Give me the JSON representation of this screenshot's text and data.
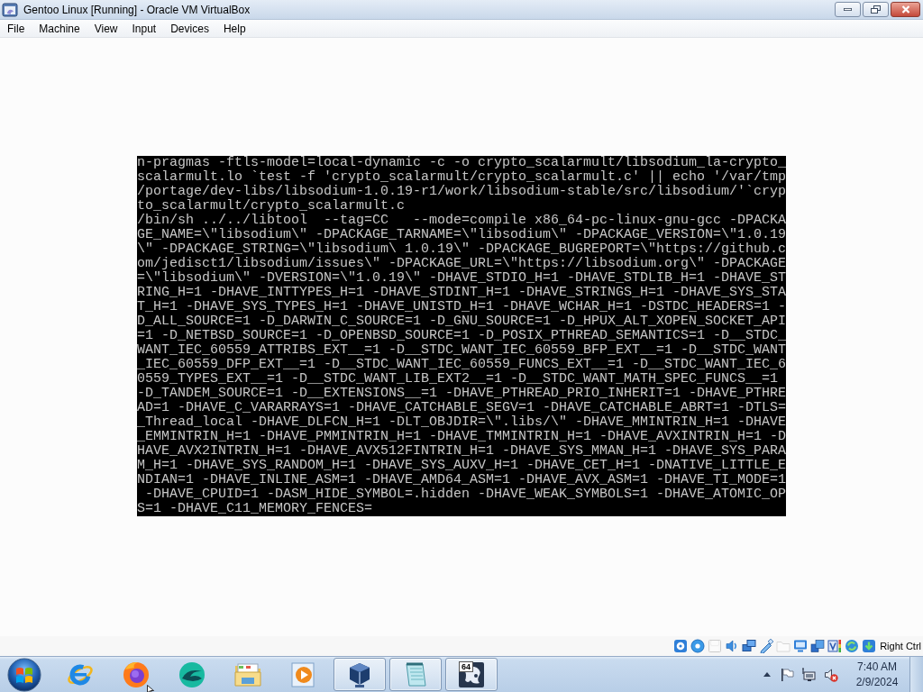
{
  "window": {
    "title": "Gentoo Linux [Running] - Oracle VM VirtualBox"
  },
  "menu": [
    "File",
    "Machine",
    "View",
    "Input",
    "Devices",
    "Help"
  ],
  "screen": {
    "lines": [
      "n-pragmas -ftls-model=local-dynamic -c -o crypto_scalarmult/libsodium_la-crypto_",
      "scalarmult.lo `test -f 'crypto_scalarmult/crypto_scalarmult.c' || echo '/var/tmp",
      "/portage/dev-libs/libsodium-1.0.19-r1/work/libsodium-stable/src/libsodium/'`cryp",
      "to_scalarmult/crypto_scalarmult.c",
      "/bin/sh ../../libtool  --tag=CC   --mode=compile x86_64-pc-linux-gnu-gcc -DPACKA",
      "GE_NAME=\\\"libsodium\\\" -DPACKAGE_TARNAME=\\\"libsodium\\\" -DPACKAGE_VERSION=\\\"1.0.19",
      "\\\" -DPACKAGE_STRING=\\\"libsodium\\ 1.0.19\\\" -DPACKAGE_BUGREPORT=\\\"https://github.c",
      "om/jedisct1/libsodium/issues\\\" -DPACKAGE_URL=\\\"https://libsodium.org\\\" -DPACKAGE",
      "=\\\"libsodium\\\" -DVERSION=\\\"1.0.19\\\" -DHAVE_STDIO_H=1 -DHAVE_STDLIB_H=1 -DHAVE_ST",
      "RING_H=1 -DHAVE_INTTYPES_H=1 -DHAVE_STDINT_H=1 -DHAVE_STRINGS_H=1 -DHAVE_SYS_STA",
      "T_H=1 -DHAVE_SYS_TYPES_H=1 -DHAVE_UNISTD_H=1 -DHAVE_WCHAR_H=1 -DSTDC_HEADERS=1 -",
      "D_ALL_SOURCE=1 -D_DARWIN_C_SOURCE=1 -D_GNU_SOURCE=1 -D_HPUX_ALT_XOPEN_SOCKET_API",
      "=1 -D_NETBSD_SOURCE=1 -D_OPENBSD_SOURCE=1 -D_POSIX_PTHREAD_SEMANTICS=1 -D__STDC_",
      "WANT_IEC_60559_ATTRIBS_EXT__=1 -D__STDC_WANT_IEC_60559_BFP_EXT__=1 -D__STDC_WANT",
      "_IEC_60559_DFP_EXT__=1 -D__STDC_WANT_IEC_60559_FUNCS_EXT__=1 -D__STDC_WANT_IEC_6",
      "0559_TYPES_EXT__=1 -D__STDC_WANT_LIB_EXT2__=1 -D__STDC_WANT_MATH_SPEC_FUNCS__=1",
      "-D_TANDEM_SOURCE=1 -D__EXTENSIONS__=1 -DHAVE_PTHREAD_PRIO_INHERIT=1 -DHAVE_PTHRE",
      "AD=1 -DHAVE_C_VARARRAYS=1 -DHAVE_CATCHABLE_SEGV=1 -DHAVE_CATCHABLE_ABRT=1 -DTLS=",
      "_Thread_local -DHAVE_DLFCN_H=1 -DLT_OBJDIR=\\\".libs/\\\" -DHAVE_MMINTRIN_H=1 -DHAVE",
      "_EMMINTRIN_H=1 -DHAVE_PMMINTRIN_H=1 -DHAVE_TMMINTRIN_H=1 -DHAVE_AVXINTRIN_H=1 -D",
      "HAVE_AVX2INTRIN_H=1 -DHAVE_AVX512FINTRIN_H=1 -DHAVE_SYS_MMAN_H=1 -DHAVE_SYS_PARA",
      "M_H=1 -DHAVE_SYS_RANDOM_H=1 -DHAVE_SYS_AUXV_H=1 -DHAVE_CET_H=1 -DNATIVE_LITTLE_E",
      "NDIAN=1 -DHAVE_INLINE_ASM=1 -DHAVE_AMD64_ASM=1 -DHAVE_AVX_ASM=1 -DHAVE_TI_MODE=1",
      " -DHAVE_CPUID=1 -DASM_HIDE_SYMBOL=.hidden -DHAVE_WEAK_SYMBOLS=1 -DHAVE_ATOMIC_OP",
      "S=1 -DHAVE_C11_MEMORY_FENCES="
    ]
  },
  "status_bar": {
    "indicators": [
      {
        "kind": "disk",
        "disabled": false
      },
      {
        "kind": "optical",
        "disabled": false
      },
      {
        "kind": "floppy",
        "disabled": true
      },
      {
        "kind": "audio",
        "disabled": false
      },
      {
        "kind": "network",
        "disabled": false
      },
      {
        "kind": "usb",
        "disabled": false
      },
      {
        "kind": "shared",
        "disabled": true
      },
      {
        "kind": "display",
        "disabled": false
      },
      {
        "kind": "capture",
        "disabled": false
      },
      {
        "kind": "engine",
        "disabled": false
      },
      {
        "kind": "mouse",
        "disabled": false
      },
      {
        "kind": "keyboard",
        "disabled": false
      }
    ],
    "host_key": "Right Ctrl"
  },
  "taskbar": {
    "items": [
      {
        "kind": "ie",
        "running": false
      },
      {
        "kind": "firefox",
        "running": false
      },
      {
        "kind": "swirl",
        "running": false
      },
      {
        "kind": "folder",
        "running": false
      },
      {
        "kind": "media",
        "running": false
      },
      {
        "kind": "cube",
        "running": true
      },
      {
        "kind": "notepad",
        "running": true
      },
      {
        "kind": "app64",
        "running": true,
        "badge": "64"
      }
    ],
    "tray": {
      "muted": true,
      "time": "7:40 AM",
      "date": "2/9/2024"
    }
  }
}
